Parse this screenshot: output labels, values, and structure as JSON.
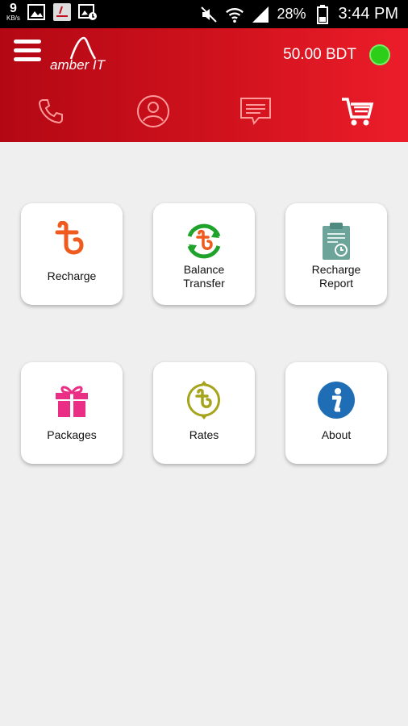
{
  "status_bar": {
    "net_speed_value": "9",
    "net_speed_unit": "KB/s",
    "battery": "28%",
    "time": "3:44 PM"
  },
  "header": {
    "logo_text": "amber IT",
    "balance": "50.00 BDT",
    "status_color": "#2dce1a",
    "nav_icons": [
      "phone-icon",
      "profile-icon",
      "message-icon",
      "cart-icon"
    ]
  },
  "tiles": [
    {
      "id": "recharge",
      "lines": [
        "Recharge"
      ],
      "icon": "taka-icon",
      "color": "#ef5a1f"
    },
    {
      "id": "balance-transfer",
      "lines": [
        "Balance",
        "Transfer"
      ],
      "icon": "taka-transfer-icon",
      "color": "#1fa32a"
    },
    {
      "id": "recharge-report",
      "lines": [
        "Recharge",
        "Report"
      ],
      "icon": "clipboard-report-icon",
      "color": "#6da49a"
    },
    {
      "id": "packages",
      "lines": [
        "Packages"
      ],
      "icon": "gift-icon",
      "color": "#ea2e86"
    },
    {
      "id": "rates",
      "lines": [
        "Rates"
      ],
      "icon": "rates-icon",
      "color": "#a6a41c"
    },
    {
      "id": "about",
      "lines": [
        "About"
      ],
      "icon": "info-icon",
      "color": "#1f6db5"
    }
  ]
}
